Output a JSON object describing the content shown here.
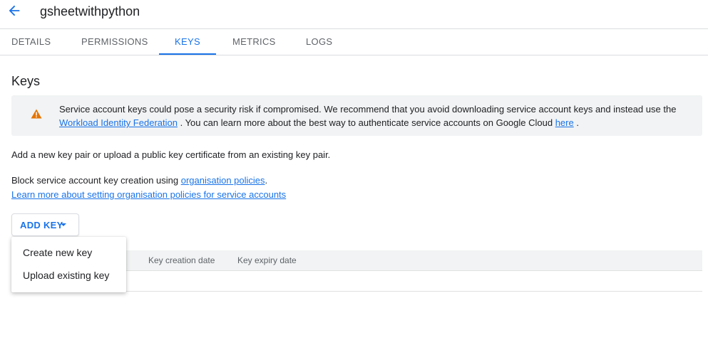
{
  "header": {
    "title": "gsheetwithpython",
    "back_icon": "arrow-back-icon"
  },
  "tabs": [
    {
      "label": "DETAILS"
    },
    {
      "label": "PERMISSIONS"
    },
    {
      "label": "KEYS",
      "active": true
    },
    {
      "label": "METRICS"
    },
    {
      "label": "LOGS"
    }
  ],
  "section": {
    "title": "Keys"
  },
  "banner": {
    "icon": "warning-icon",
    "text_1": "Service account keys could pose a security risk if compromised. We recommend that you avoid downloading service account keys and instead use the ",
    "link_1": "Workload Identity Federation",
    "text_2": " . You can learn more about the best way to authenticate service accounts on Google Cloud ",
    "link_2": "here",
    "text_3": " ."
  },
  "intro": "Add a new key pair or upload a public key certificate from an existing key pair.",
  "policy": {
    "text": "Block service account key creation using ",
    "link": "organisation policies",
    "suffix": ".",
    "learn_more": "Learn more about setting organisation policies for service accounts"
  },
  "add_key": {
    "label": "ADD KEY"
  },
  "menu": {
    "items": [
      "Create new key",
      "Upload existing key"
    ]
  },
  "table": {
    "columns": [
      "Key creation date",
      "Key expiry date"
    ]
  },
  "colors": {
    "accent": "#1a73e8",
    "warning": "#e37400"
  }
}
